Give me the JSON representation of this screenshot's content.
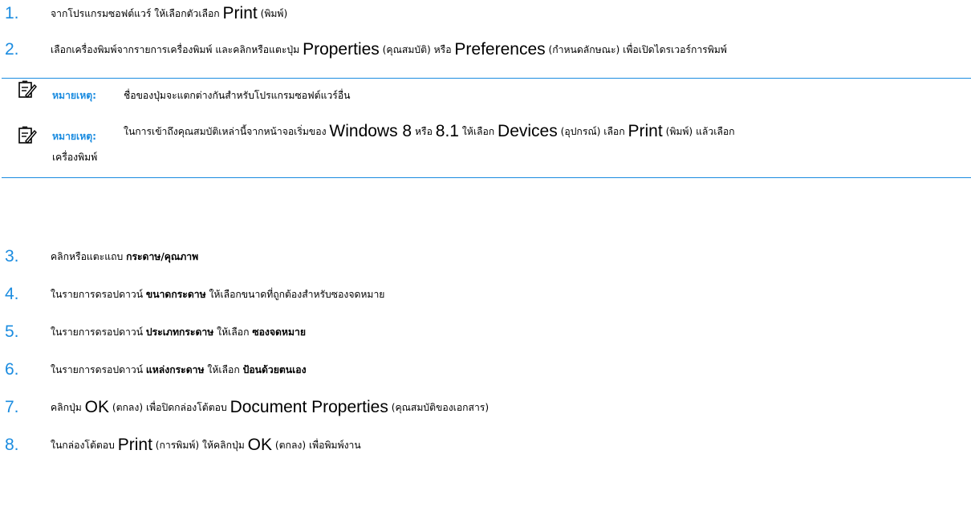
{
  "steps": [
    {
      "num": "1.",
      "t1": "จากโปรแกรมซอฟต์แวร์ ให้เลือกตัวเลือก",
      "b1": "Print",
      "t2": "(พิมพ์)"
    },
    {
      "num": "2.",
      "t1": "เลือกเครื่องพิมพ์จากรายการเครื่องพิมพ์ และคลิกหรือแตะปุ่ม",
      "b1": "Properties",
      "t2": "(คุณสมบัติ) หรือ",
      "b2": "Preferences",
      "t3": "(กำหนดลักษณะ) เพื่อเปิดไดรเวอร์การพิมพ์"
    },
    {
      "num": "3.",
      "t1": "คลิกหรือแตะแถบ",
      "bold1": "กระดาษ/คุณภาพ"
    },
    {
      "num": "4.",
      "t1": "ในรายการดรอปดาวน์",
      "bold1": "ขนาดกระดาษ",
      "t2": "ให้เลือกขนาดที่ถูกต้องสำหรับซองจดหมาย"
    },
    {
      "num": "5.",
      "t1": "ในรายการดรอปดาวน์",
      "bold1": "ประเภทกระดาษ",
      "t2": "ให้เลือก",
      "bold2": "ซองจดหมาย"
    },
    {
      "num": "6.",
      "t1": "ในรายการดรอปดาวน์",
      "bold1": "แหล่งกระดาษ",
      "t2": "ให้เลือก",
      "bold2": "ป้อนด้วยตนเอง"
    },
    {
      "num": "7.",
      "t1": "คลิกปุ่ม",
      "b1": "OK",
      "t2": "(ตกลง) เพื่อปิดกล่องโต้ตอบ",
      "b2": "Document Properties",
      "t3": "(คุณสมบัติของเอกสาร)"
    },
    {
      "num": "8.",
      "t1": "ในกล่องโต้ตอบ",
      "b1": "Print",
      "t2": "(การพิมพ์) ให้คลิกปุ่ม",
      "b2": "OK",
      "t3": "(ตกลง) เพื่อพิมพ์งาน"
    }
  ],
  "notes": [
    {
      "label": "หมายเหตุ:",
      "body": "ชื่อของปุ่มจะแตกต่างกันสำหรับโปรแกรมซอฟต์แวร์อื่น"
    },
    {
      "label": "หมายเหตุ:",
      "t1": "ในการเข้าถึงคุณสมบัติเหล่านี้จากหน้าจอเริ่มของ",
      "b1": "Windows 8",
      "t2": "หรือ",
      "b2": "8.1",
      "t3": "ให้เลือก",
      "b3": "Devices",
      "t4": "(อุปกรณ์) เลือก",
      "b4": "Print",
      "t5": "(พิมพ์) แล้วเลือก",
      "line2": "เครื่องพิมพ์"
    }
  ],
  "colors": {
    "accent": "#1b8ce0"
  }
}
